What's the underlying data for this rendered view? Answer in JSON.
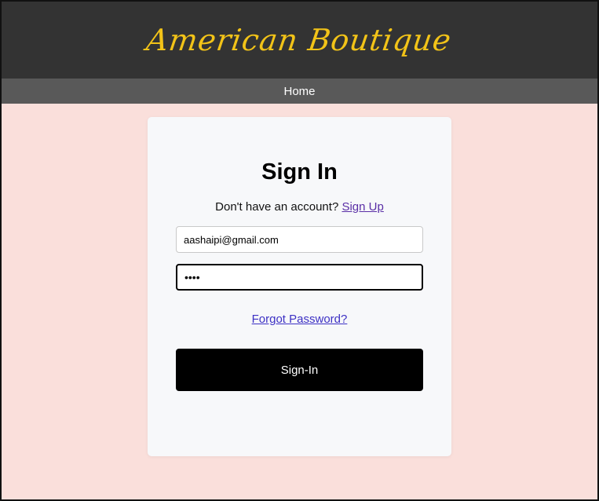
{
  "header": {
    "brand": "American Boutique"
  },
  "nav": {
    "home": "Home"
  },
  "form": {
    "title": "Sign In",
    "signup_prompt": "Don't have an account?",
    "signup_link": "Sign Up",
    "email_value": "aashaipi@gmail.com",
    "password_value": "••••",
    "forgot_link": "Forgot Password?",
    "submit_label": "Sign-In"
  },
  "colors": {
    "header_bg": "#333333",
    "brand": "#f2c318",
    "nav_bg": "#595959",
    "page_bg": "#fadfdb",
    "card_bg": "#f7f8fa",
    "button_bg": "#000000"
  }
}
